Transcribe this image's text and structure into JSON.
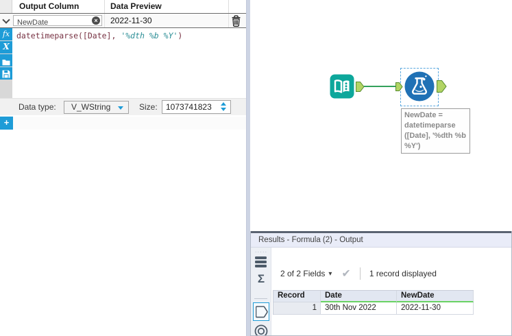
{
  "colors": {
    "accent_blue": "#1e9cd7",
    "tool_formula_blue": "#2071b5",
    "tool_input_teal": "#0da79b",
    "connection_green": "#33a15b",
    "anchor_green": "#b2d464",
    "header_underline_green": "#69d263",
    "code_color": "#773142",
    "string_color": "#2c8e96"
  },
  "config": {
    "header": {
      "col1": "Output Column",
      "col2": "Data Preview"
    },
    "row": {
      "name": "NewDate",
      "preview": "2022-11-30"
    },
    "formula": {
      "head": "datetimeparse([Date], ",
      "str": "'%dth %b %Y'",
      "tail": ")"
    },
    "rail": {
      "fx": "fx",
      "x": "X"
    },
    "datatype": {
      "label": "Data type:",
      "value": "V_WString",
      "size_label": "Size:",
      "size_value": "1073741823"
    },
    "add": "+"
  },
  "canvas": {
    "annotation": "NewDate =\ndatetimeparse\n([Date], '%dth %b\n%Y')"
  },
  "results": {
    "title": "Results - Formula (2) - Output",
    "fields": "2 of 2 Fields",
    "records": "1 record displayed",
    "headers": [
      "Record",
      "Date",
      "NewDate"
    ],
    "row": {
      "num": "1",
      "date": "30th Nov 2022",
      "newdate": "2022-11-30"
    }
  },
  "icons": {
    "sigma": "Σ",
    "check": "✔",
    "caret": "▾",
    "grip": "·····",
    "clear": "×"
  }
}
